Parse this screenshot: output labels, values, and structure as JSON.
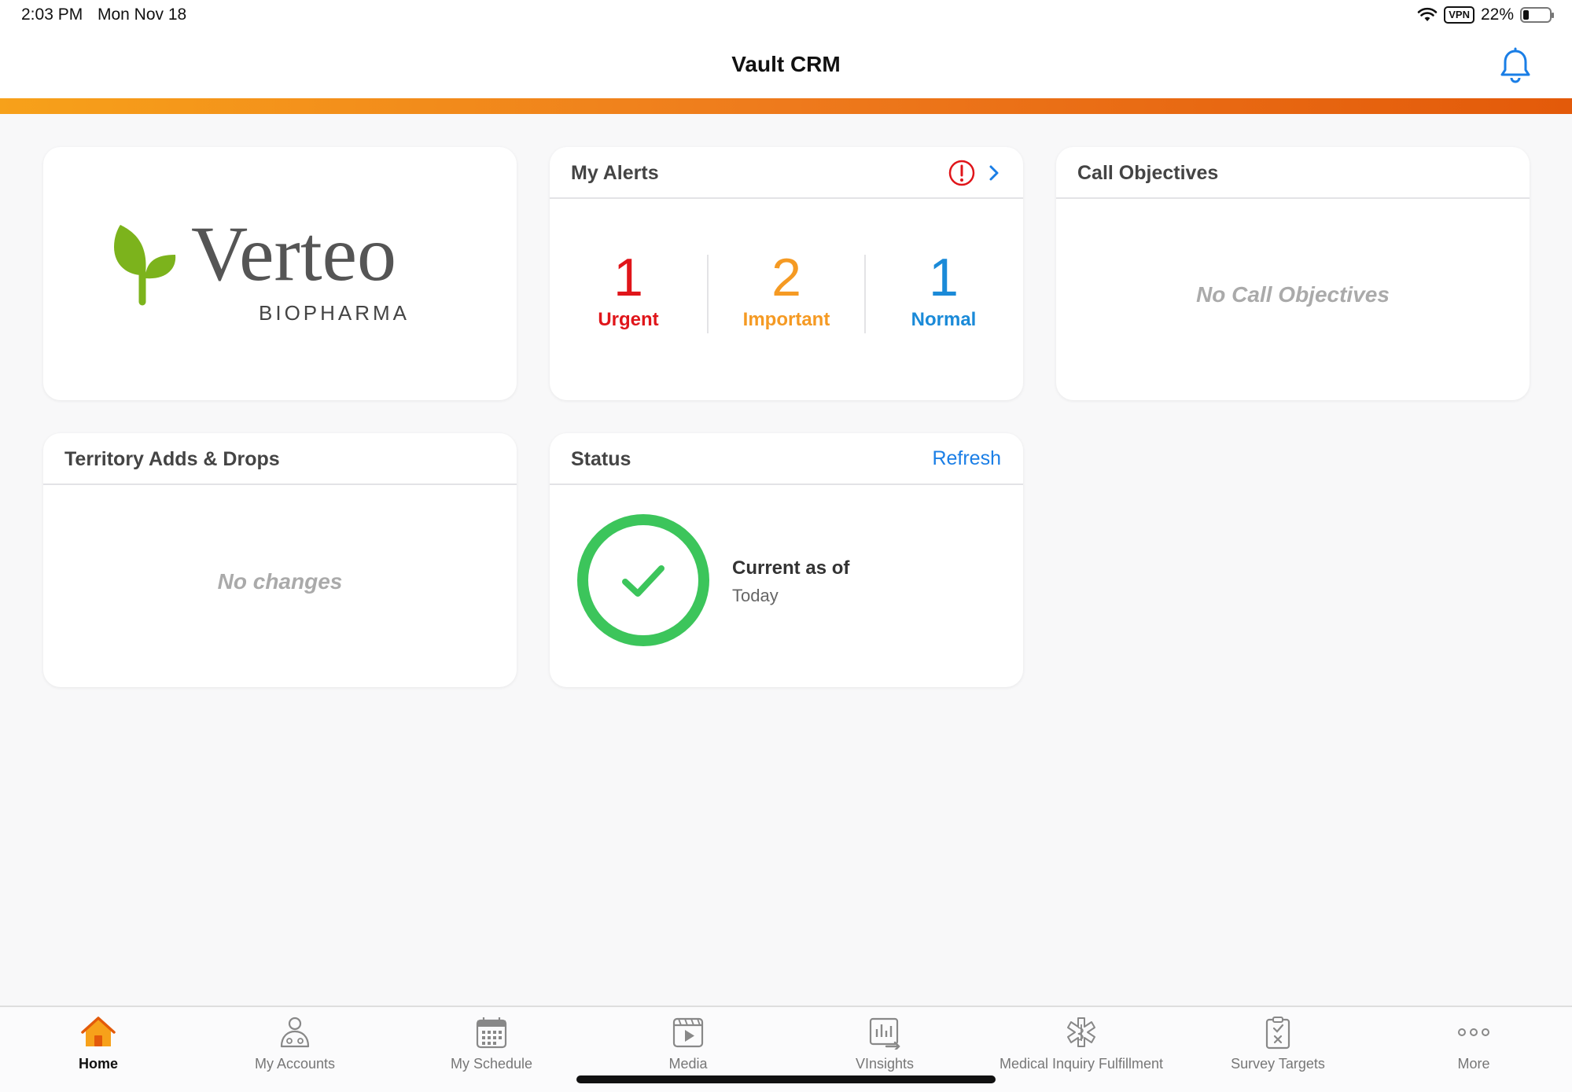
{
  "status_bar": {
    "time": "2:03 PM",
    "date": "Mon Nov 18",
    "vpn": "VPN",
    "battery": "22%",
    "battery_level": 0.22
  },
  "header": {
    "title": "Vault CRM"
  },
  "logo": {
    "brand": "Verteo",
    "tagline": "BIOPHARMA",
    "leaf_color": "#7cb31c"
  },
  "alerts": {
    "title": "My Alerts",
    "items": [
      {
        "count": "1",
        "label": "Urgent",
        "color": "#e0151a"
      },
      {
        "count": "2",
        "label": "Important",
        "color": "#f59a23"
      },
      {
        "count": "1",
        "label": "Normal",
        "color": "#1a8ad8"
      }
    ]
  },
  "call_objectives": {
    "title": "Call Objectives",
    "empty_text": "No Call Objectives"
  },
  "territory": {
    "title": "Territory Adds & Drops",
    "empty_text": "No changes"
  },
  "status": {
    "title": "Status",
    "refresh_label": "Refresh",
    "line1": "Current as of",
    "line2": "Today",
    "color": "#3cc55b"
  },
  "tabs": [
    {
      "label": "Home",
      "icon": "home-icon",
      "active": true
    },
    {
      "label": "My Accounts",
      "icon": "accounts-icon"
    },
    {
      "label": "My Schedule",
      "icon": "calendar-icon"
    },
    {
      "label": "Media",
      "icon": "media-icon"
    },
    {
      "label": "VInsights",
      "icon": "insights-icon"
    },
    {
      "label": "Medical Inquiry Fulfillment",
      "icon": "medical-icon"
    },
    {
      "label": "Survey Targets",
      "icon": "survey-icon"
    },
    {
      "label": "More",
      "icon": "more-icon"
    }
  ],
  "colors": {
    "accent_orange": "#ee7a1c",
    "link_blue": "#1a7ee6"
  }
}
